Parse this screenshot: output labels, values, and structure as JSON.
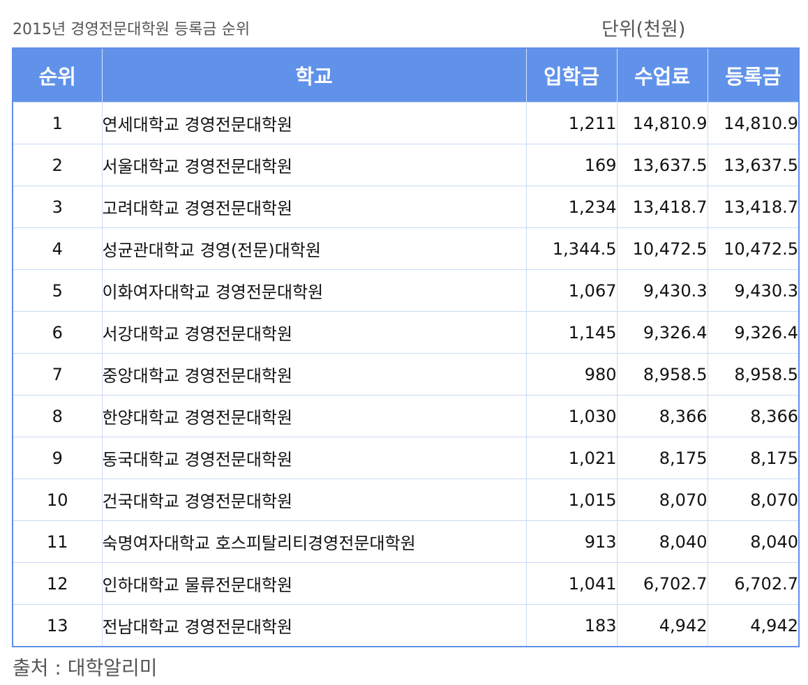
{
  "caption": {
    "title": "2015년 경영전문대학원 등록금 순위",
    "unit": "단위(천원)"
  },
  "table": {
    "headers": [
      "순위",
      "학교",
      "입학금",
      "수업료",
      "등록금"
    ],
    "rows": [
      [
        "1",
        "연세대학교 경영전문대학원",
        "1,211",
        "14,810.9",
        "14,810.9"
      ],
      [
        "2",
        "서울대학교 경영전문대학원",
        "169",
        "13,637.5",
        "13,637.5"
      ],
      [
        "3",
        "고려대학교 경영전문대학원",
        "1,234",
        "13,418.7",
        "13,418.7"
      ],
      [
        "4",
        "성균관대학교 경영(전문)대학원",
        "1,344.5",
        "10,472.5",
        "10,472.5"
      ],
      [
        "5",
        "이화여자대학교 경영전문대학원",
        "1,067",
        "9,430.3",
        "9,430.3"
      ],
      [
        "6",
        "서강대학교 경영전문대학원",
        "1,145",
        "9,326.4",
        "9,326.4"
      ],
      [
        "7",
        "중앙대학교 경영전문대학원",
        "980",
        "8,958.5",
        "8,958.5"
      ],
      [
        "8",
        "한양대학교 경영전문대학원",
        "1,030",
        "8,366",
        "8,366"
      ],
      [
        "9",
        "동국대학교 경영전문대학원",
        "1,021",
        "8,175",
        "8,175"
      ],
      [
        "10",
        "건국대학교 경영전문대학원",
        "1,015",
        "8,070",
        "8,070"
      ],
      [
        "11",
        "숙명여자대학교 호스피탈리티경영전문대학원",
        "913",
        "8,040",
        "8,040"
      ],
      [
        "12",
        "인하대학교 물류전문대학원",
        "1,041",
        "6,702.7",
        "6,702.7"
      ],
      [
        "13",
        "전남대학교 경영전문대학원",
        "183",
        "4,942",
        "4,942"
      ]
    ]
  },
  "source": "출처 : 대학알리미",
  "colors": {
    "header_bg": "#6192ea",
    "header_text": "#ffffff",
    "grid": "#c9d9f6",
    "caption_text": "#555555"
  }
}
